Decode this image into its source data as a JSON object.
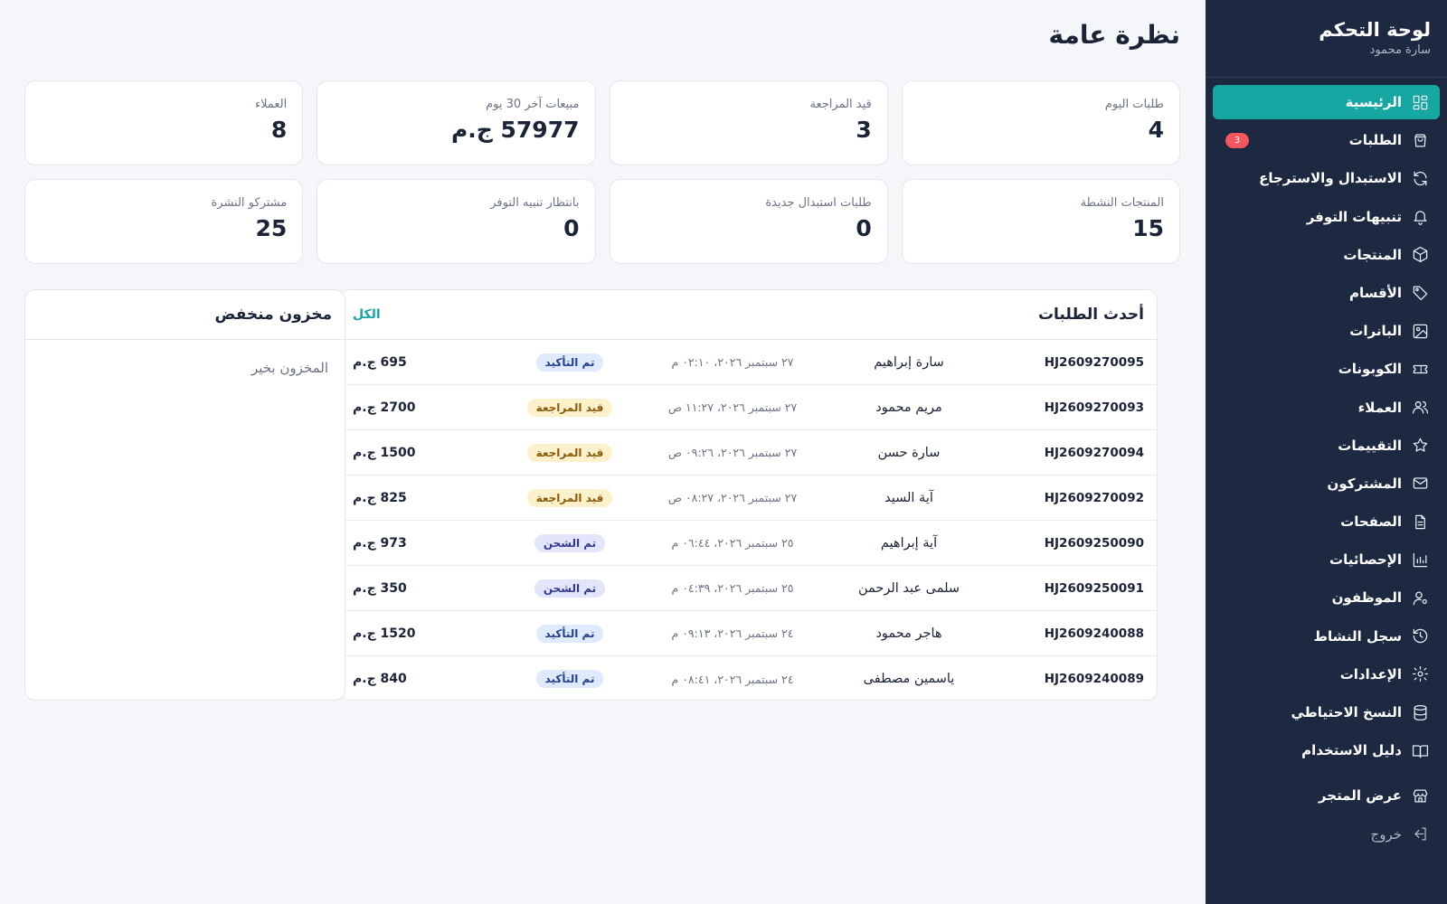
{
  "sidebar": {
    "title": "لوحة التحكم",
    "user": "سارة محمود",
    "items": [
      {
        "label": "الرئيسية",
        "icon": "dashboard-icon",
        "active": true
      },
      {
        "label": "الطلبات",
        "icon": "bag-icon",
        "badge": "3"
      },
      {
        "label": "الاستبدال والاسترجاع",
        "icon": "refresh-icon"
      },
      {
        "label": "تنبيهات التوفر",
        "icon": "bell-icon"
      },
      {
        "label": "المنتجات",
        "icon": "box-icon"
      },
      {
        "label": "الأقسام",
        "icon": "tag-icon"
      },
      {
        "label": "البانرات",
        "icon": "image-icon"
      },
      {
        "label": "الكوبونات",
        "icon": "ticket-icon"
      },
      {
        "label": "العملاء",
        "icon": "users-icon"
      },
      {
        "label": "التقييمات",
        "icon": "star-icon"
      },
      {
        "label": "المشتركون",
        "icon": "mail-icon"
      },
      {
        "label": "الصفحات",
        "icon": "file-icon"
      },
      {
        "label": "الإحصائيات",
        "icon": "bar-chart-icon"
      },
      {
        "label": "الموظفون",
        "icon": "user-cog-icon"
      },
      {
        "label": "سجل النشاط",
        "icon": "history-icon"
      },
      {
        "label": "الإعدادات",
        "icon": "gear-icon"
      },
      {
        "label": "النسخ الاحتياطي",
        "icon": "database-icon"
      },
      {
        "label": "دليل الاستخدام",
        "icon": "book-icon"
      }
    ],
    "store_label": "عرض المتجر",
    "logout_label": "خروج"
  },
  "page_title": "نظرة عامة",
  "stats": [
    {
      "label": "طلبات اليوم",
      "value": "4"
    },
    {
      "label": "قيد المراجعة",
      "value": "3"
    },
    {
      "label": "مبيعات آخر 30 يوم",
      "value": "57977 ج.م"
    },
    {
      "label": "العملاء",
      "value": "8"
    },
    {
      "label": "المنتجات النشطة",
      "value": "15"
    },
    {
      "label": "طلبات استبدال جديدة",
      "value": "0"
    },
    {
      "label": "بانتظار تنبيه التوفر",
      "value": "0"
    },
    {
      "label": "مشتركو النشرة",
      "value": "25"
    }
  ],
  "orders": {
    "title": "أحدث الطلبات",
    "view_all": "الكل",
    "rows": [
      {
        "id": "HJ2609270095",
        "customer": "سارة إبراهيم",
        "date": "٢٧ سبتمبر ٢٠٢٦، ٠٢:١٠ م",
        "status": "تم التأكيد",
        "status_key": "confirmed",
        "total": "695 ج.م"
      },
      {
        "id": "HJ2609270093",
        "customer": "مريم محمود",
        "date": "٢٧ سبتمبر ٢٠٢٦، ١١:٢٧ ص",
        "status": "قيد المراجعة",
        "status_key": "review",
        "total": "2700 ج.م"
      },
      {
        "id": "HJ2609270094",
        "customer": "سارة حسن",
        "date": "٢٧ سبتمبر ٢٠٢٦، ٠٩:٢٦ ص",
        "status": "قيد المراجعة",
        "status_key": "review",
        "total": "1500 ج.م"
      },
      {
        "id": "HJ2609270092",
        "customer": "آية السيد",
        "date": "٢٧ سبتمبر ٢٠٢٦، ٠٨:٢٧ ص",
        "status": "قيد المراجعة",
        "status_key": "review",
        "total": "825 ج.م"
      },
      {
        "id": "HJ2609250090",
        "customer": "آية إبراهيم",
        "date": "٢٥ سبتمبر ٢٠٢٦، ٠٦:٤٤ م",
        "status": "تم الشحن",
        "status_key": "shipped",
        "total": "973 ج.م"
      },
      {
        "id": "HJ2609250091",
        "customer": "سلمى عبد الرحمن",
        "date": "٢٥ سبتمبر ٢٠٢٦، ٠٤:٣٩ م",
        "status": "تم الشحن",
        "status_key": "shipped",
        "total": "350 ج.م"
      },
      {
        "id": "HJ2609240088",
        "customer": "هاجر محمود",
        "date": "٢٤ سبتمبر ٢٠٢٦، ٠٩:١٣ م",
        "status": "تم التأكيد",
        "status_key": "confirmed",
        "total": "1520 ج.م"
      },
      {
        "id": "HJ2609240089",
        "customer": "ياسمين مصطفى",
        "date": "٢٤ سبتمبر ٢٠٢٦، ٠٨:٤١ م",
        "status": "تم التأكيد",
        "status_key": "confirmed",
        "total": "840 ج.م"
      }
    ]
  },
  "low_stock": {
    "title": "مخزون منخفض",
    "empty_text": "المخزون بخير"
  },
  "colors": {
    "sidebar_bg": "#1d2940",
    "accent": "#17a7a3",
    "badge": "#f2575e",
    "page_bg": "#f4f6f9"
  }
}
